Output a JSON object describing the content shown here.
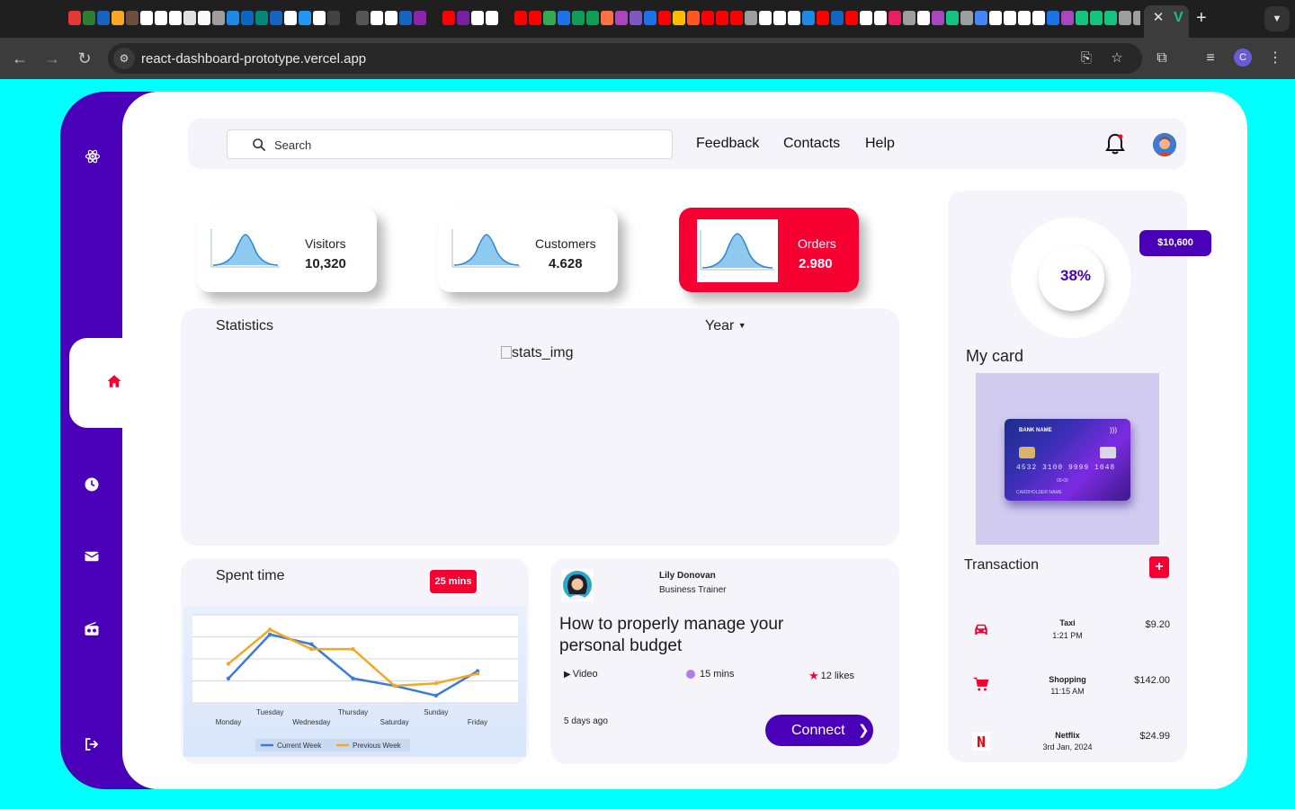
{
  "browser": {
    "url": "react-dashboard-prototype.vercel.app",
    "tab_close": "✕",
    "tab_favicon_letter": "V",
    "new_tab": "+",
    "profile_letter": "C",
    "tab_favicon_colors": [
      "#e53935",
      "#2e7d32",
      "#1565c0",
      "#f9a825",
      "#6d4c41",
      "#fff",
      "#fff",
      "#fff",
      "#e0e0e0",
      "#fafafa",
      "#9e9e9e",
      "#1e88e5",
      "#0a66c2",
      "#00897b",
      "#1565c0",
      "#fff",
      "#2196f3",
      "#fff",
      "#424242",
      "#1f1f1f",
      "#555",
      "#fff",
      "#fff",
      "#1565c0",
      "#8e24aa",
      "#1f1f1f",
      "#ff0000",
      "#7b1fa2",
      "#fff",
      "#fff",
      "#1f1f1f",
      "#ff0000",
      "#ff0000",
      "#34a853",
      "#1a73e8",
      "#0f9d58",
      "#0f9d58",
      "#ff7043",
      "#ab47bc",
      "#7e57c2",
      "#1a73e8",
      "#ff0000",
      "#fbbc04",
      "#ff5722",
      "#ff0000",
      "#ff0000",
      "#ff0000",
      "#9e9e9e",
      "#fff",
      "#fff",
      "#fff",
      "#1e88e5",
      "#ff0000",
      "#1565c0",
      "#ff0000",
      "#fff",
      "#fff",
      "#e91e63",
      "#9e9e9e",
      "#fff",
      "#ab47bc",
      "#16c47f",
      "#9e9e9e",
      "#4285f4",
      "#fff",
      "#fff",
      "#fff",
      "#fff",
      "#1a73e8",
      "#ab47bc",
      "#16c47f",
      "#16c47f",
      "#16c47f",
      "#9e9e9e",
      "#9e9e9e"
    ]
  },
  "header": {
    "search_placeholder": "Search",
    "links": [
      "Feedback",
      "Contacts",
      "Help"
    ]
  },
  "stats_cards": [
    {
      "label": "Visitors",
      "value": "10,320"
    },
    {
      "label": "Customers",
      "value": "4.628"
    },
    {
      "label": "Orders",
      "value": "2.980"
    }
  ],
  "statistics": {
    "title": "Statistics",
    "period": "Year",
    "image_alt": "stats_img"
  },
  "spent_time": {
    "title": "Spent time",
    "badge": "25 mins"
  },
  "chart_data": {
    "type": "line",
    "categories": [
      "Monday",
      "Tuesday",
      "Wednesday",
      "Thursday",
      "Saturday",
      "Sunday",
      "Friday"
    ],
    "series": [
      {
        "name": "Current Week",
        "values": [
          3,
          12,
          10,
          3,
          1.5,
          -0.5,
          4.5
        ],
        "color": "#3a7bd5"
      },
      {
        "name": "Previous Week",
        "values": [
          6,
          13,
          9,
          9,
          1.5,
          2,
          4
        ],
        "color": "#f5a623"
      }
    ],
    "ylim": [
      -2,
      16
    ],
    "grid": true,
    "legend": "bottom"
  },
  "article": {
    "author": "Lily Donovan",
    "role": "Business Trainer",
    "title": "How to properly manage your personal budget",
    "type": "Video",
    "duration": "15 mins",
    "likes": "12 likes",
    "posted": "5 days ago",
    "cta": "Connect"
  },
  "wallet": {
    "percent": "38%",
    "percent_value": 38,
    "balance": "$10,600",
    "card_title": "My card",
    "card": {
      "bank": "BANK NAME",
      "number": "4532 3100 9999 1048",
      "expiry": "00-00",
      "holder": "CARDHOLDER NAME"
    }
  },
  "transactions": {
    "title": "Transaction",
    "add_label": "+",
    "items": [
      {
        "name": "Taxi",
        "time": "1:21 PM",
        "amount": "$9.20",
        "icon": "car-icon"
      },
      {
        "name": "Shopping",
        "time": "11:15 AM",
        "amount": "$142.00",
        "icon": "cart-icon"
      },
      {
        "name": "Netflix",
        "time": "3rd Jan, 2024",
        "amount": "$24.99",
        "icon": "netflix-icon"
      }
    ]
  },
  "colors": {
    "brand_purple": "#4a00b8",
    "accent_red": "#f50031",
    "background_cyan": "#00ffff",
    "panel": "#f5f4fb"
  }
}
